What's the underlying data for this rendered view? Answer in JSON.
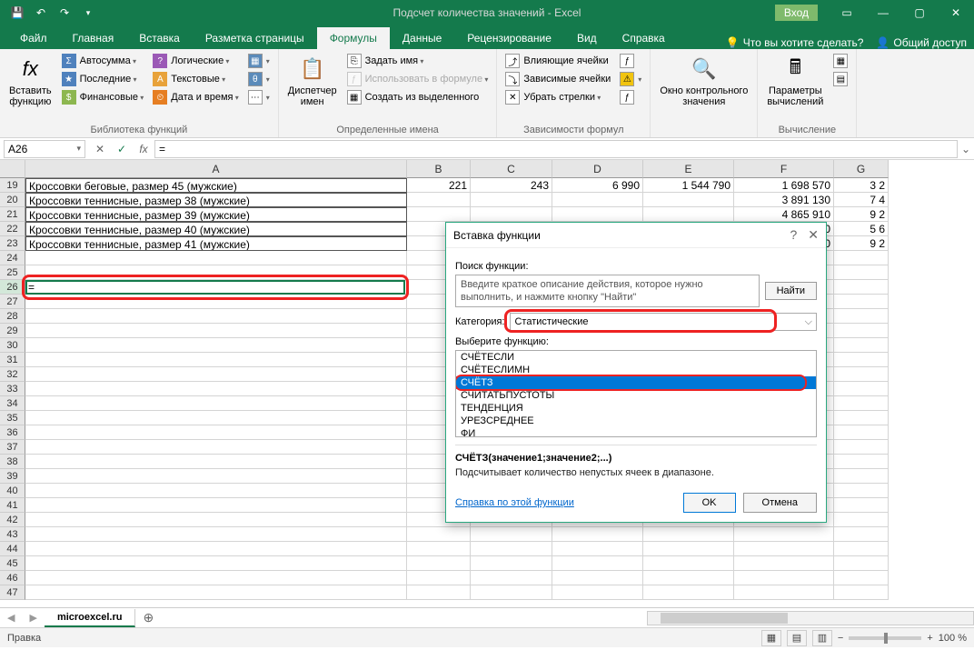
{
  "titlebar": {
    "title": "Подсчет количества значений  -  Excel",
    "login": "Вход"
  },
  "tabs": {
    "file": "Файл",
    "home": "Главная",
    "insert": "Вставка",
    "layout": "Разметка страницы",
    "formulas": "Формулы",
    "data": "Данные",
    "review": "Рецензирование",
    "view": "Вид",
    "help": "Справка",
    "tellme": "Что вы хотите сделать?",
    "share": "Общий доступ"
  },
  "ribbon": {
    "insert_fn": "Вставить\nфункцию",
    "autosum": "Автосумма",
    "recent": "Последние",
    "financial": "Финансовые",
    "logical": "Логические",
    "text": "Текстовые",
    "datetime": "Дата и время",
    "lookup_icon": "▦",
    "math_icon": "θ",
    "more_icon": "⋯",
    "lib_label": "Библиотека функций",
    "name_mgr": "Диспетчер\nимен",
    "define_name": "Задать имя",
    "use_in_formula": "Использовать в формуле",
    "create_from_sel": "Создать из выделенного",
    "names_label": "Определенные имена",
    "trace_prec": "Влияющие ячейки",
    "trace_dep": "Зависимые ячейки",
    "remove_arr": "Убрать стрелки",
    "deps_label": "Зависимости формул",
    "watch": "Окно контрольного\nзначения",
    "calc_opts": "Параметры\nвычислений",
    "calc_label": "Вычисление"
  },
  "formula_bar": {
    "name_box": "A26",
    "formula": "="
  },
  "columns": [
    "A",
    "B",
    "C",
    "D",
    "E",
    "F",
    "G"
  ],
  "rows": [
    {
      "n": 19,
      "A": "Кроссовки беговые, размер 45 (мужские)",
      "B": "221",
      "C": "243",
      "D": "6 990",
      "E": "1 544 790",
      "F": "1 698 570",
      "G": "3 2"
    },
    {
      "n": 20,
      "A": "Кроссовки теннисные, размер 38 (мужские)",
      "B": "",
      "C": "",
      "D": "",
      "E": "",
      "F": "3 891 130",
      "G": "7 4"
    },
    {
      "n": 21,
      "A": "Кроссовки теннисные, размер 39 (мужские)",
      "B": "",
      "C": "",
      "D": "",
      "E": "",
      "F": "4 865 910",
      "G": "9 2"
    },
    {
      "n": 22,
      "A": "Кроссовки теннисные, размер 40 (мужские)",
      "B": "",
      "C": "",
      "D": "",
      "E": "",
      "F": "2 932 330",
      "G": "5 6"
    },
    {
      "n": 23,
      "A": "Кроссовки теннисные, размер 41 (мужские)",
      "B": "",
      "C": "",
      "D": "",
      "E": "",
      "F": "4 857 920",
      "G": "9 2"
    },
    {
      "n": 24,
      "A": "",
      "B": "",
      "C": "",
      "D": "",
      "E": "",
      "F": "",
      "G": ""
    },
    {
      "n": 25,
      "A": "",
      "B": "",
      "C": "",
      "D": "",
      "E": "",
      "F": "",
      "G": ""
    },
    {
      "n": 26,
      "A": "=",
      "B": "",
      "C": "",
      "D": "",
      "E": "",
      "F": "",
      "G": ""
    },
    {
      "n": 27,
      "A": "",
      "B": "",
      "C": "",
      "D": "",
      "E": "",
      "F": "",
      "G": ""
    },
    {
      "n": 28,
      "A": "",
      "B": "",
      "C": "",
      "D": "",
      "E": "",
      "F": "",
      "G": ""
    },
    {
      "n": 29,
      "A": "",
      "B": "",
      "C": "",
      "D": "",
      "E": "",
      "F": "",
      "G": ""
    },
    {
      "n": 30,
      "A": "",
      "B": "",
      "C": "",
      "D": "",
      "E": "",
      "F": "",
      "G": ""
    },
    {
      "n": 31,
      "A": "",
      "B": "",
      "C": "",
      "D": "",
      "E": "",
      "F": "",
      "G": ""
    },
    {
      "n": 32,
      "A": "",
      "B": "",
      "C": "",
      "D": "",
      "E": "",
      "F": "",
      "G": ""
    },
    {
      "n": 33,
      "A": "",
      "B": "",
      "C": "",
      "D": "",
      "E": "",
      "F": "",
      "G": ""
    },
    {
      "n": 34,
      "A": "",
      "B": "",
      "C": "",
      "D": "",
      "E": "",
      "F": "",
      "G": ""
    },
    {
      "n": 35,
      "A": "",
      "B": "",
      "C": "",
      "D": "",
      "E": "",
      "F": "",
      "G": ""
    },
    {
      "n": 36,
      "A": "",
      "B": "",
      "C": "",
      "D": "",
      "E": "",
      "F": "",
      "G": ""
    },
    {
      "n": 37,
      "A": "",
      "B": "",
      "C": "",
      "D": "",
      "E": "",
      "F": "",
      "G": ""
    },
    {
      "n": 38,
      "A": "",
      "B": "",
      "C": "",
      "D": "",
      "E": "",
      "F": "",
      "G": ""
    },
    {
      "n": 39,
      "A": "",
      "B": "",
      "C": "",
      "D": "",
      "E": "",
      "F": "",
      "G": ""
    },
    {
      "n": 40,
      "A": "",
      "B": "",
      "C": "",
      "D": "",
      "E": "",
      "F": "",
      "G": ""
    },
    {
      "n": 41,
      "A": "",
      "B": "",
      "C": "",
      "D": "",
      "E": "",
      "F": "",
      "G": ""
    },
    {
      "n": 42,
      "A": "",
      "B": "",
      "C": "",
      "D": "",
      "E": "",
      "F": "",
      "G": ""
    },
    {
      "n": 43,
      "A": "",
      "B": "",
      "C": "",
      "D": "",
      "E": "",
      "F": "",
      "G": ""
    },
    {
      "n": 44,
      "A": "",
      "B": "",
      "C": "",
      "D": "",
      "E": "",
      "F": "",
      "G": ""
    },
    {
      "n": 45,
      "A": "",
      "B": "",
      "C": "",
      "D": "",
      "E": "",
      "F": "",
      "G": ""
    },
    {
      "n": 46,
      "A": "",
      "B": "",
      "C": "",
      "D": "",
      "E": "",
      "F": "",
      "G": ""
    },
    {
      "n": 47,
      "A": "",
      "B": "",
      "C": "",
      "D": "",
      "E": "",
      "F": "",
      "G": ""
    }
  ],
  "sheets": {
    "active": "microexcel.ru"
  },
  "statusbar": {
    "mode": "Правка",
    "zoom": "100 %"
  },
  "dialog": {
    "title": "Вставка функции",
    "search_label": "Поиск функции:",
    "search_hint": "Введите краткое описание действия, которое нужно выполнить, и нажмите кнопку \"Найти\"",
    "find_btn": "Найти",
    "category_label": "Категория:",
    "category_value": "Статистические",
    "select_label": "Выберите функцию:",
    "functions": [
      "СЧЁТЕСЛИ",
      "СЧЁТЕСЛИМН",
      "СЧЁТЗ",
      "СЧИТАТЬПУСТОТЫ",
      "ТЕНДЕНЦИЯ",
      "УРЕЗСРЕДНЕЕ",
      "ФИ"
    ],
    "selected_fn": "СЧЁТЗ",
    "signature": "СЧЁТЗ(значение1;значение2;...)",
    "description": "Подсчитывает количество непустых ячеек в диапазоне.",
    "help_link": "Справка по этой функции",
    "ok": "OK",
    "cancel": "Отмена"
  }
}
